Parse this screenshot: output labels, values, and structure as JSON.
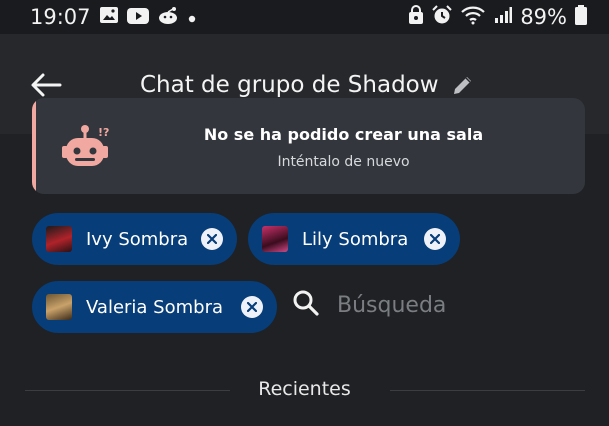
{
  "status_bar": {
    "time": "19:07",
    "left_icons": [
      "gallery-icon",
      "youtube-icon",
      "reddit-icon",
      "dot-icon"
    ],
    "right_icons": [
      "vpn-lock-icon",
      "alarm-icon",
      "wifi-icon",
      "signal-icon"
    ],
    "battery": "89%"
  },
  "header": {
    "title": "Chat de grupo de Shadow"
  },
  "error_banner": {
    "title": "No se ha podido crear una sala",
    "subtitle": "Inténtalo de nuevo",
    "accent_color": "#f1a8a0"
  },
  "selected_users": [
    {
      "name": "Ivy Sombra"
    },
    {
      "name": "Lily Sombra"
    },
    {
      "name": "Valeria Sombra"
    }
  ],
  "search": {
    "placeholder": "Búsqueda"
  },
  "recent_section": {
    "label": "Recientes"
  },
  "colors": {
    "background": "#1f2124",
    "chip": "#073d78",
    "card": "#33373d"
  }
}
